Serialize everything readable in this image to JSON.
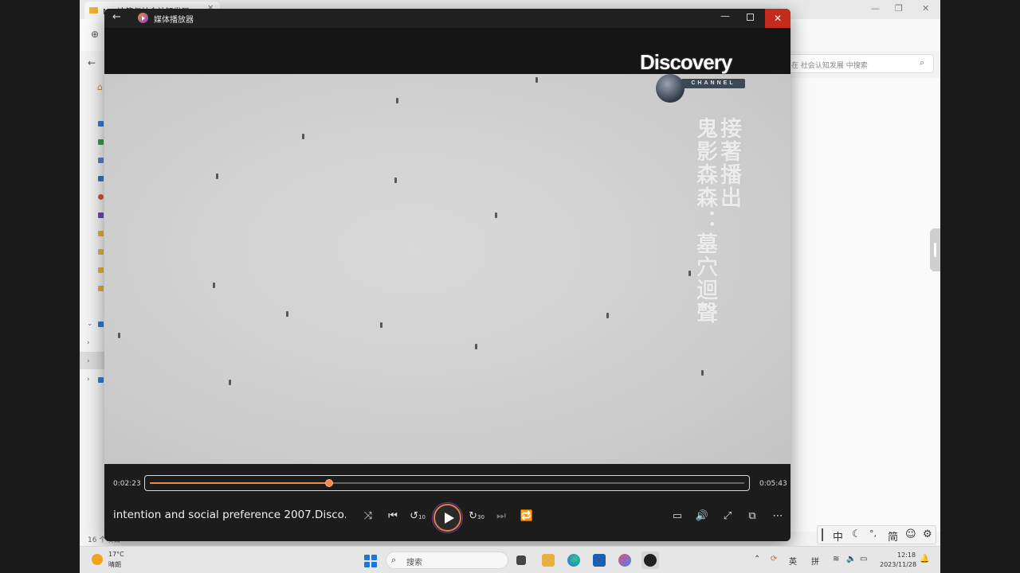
{
  "explorer": {
    "tab_title": "MCI决策与社会认知发展",
    "search_placeholder": "在 社会认知发展 中搜索",
    "status_text": "16 个项目"
  },
  "player": {
    "app_title": "媒体播放器",
    "media_title": "intention and social preference 2007.Disco...",
    "time_current": "0:02:23",
    "time_total": "0:05:43",
    "progress_fraction": 0.301,
    "logo_text": "Discovery",
    "logo_subtext": "CHANNEL",
    "caption_col1": "接著播出",
    "caption_col2": "鬼影森森：墓穴迴聲",
    "rewind_label": "10",
    "forward_label": "30"
  },
  "taskbar": {
    "weather_temp": "17°C",
    "weather_desc": "晴朗",
    "search_label": "搜索",
    "lang_label": "英",
    "ime_mode": "拼",
    "clock_time": "12:18",
    "clock_date": "2023/11/28"
  },
  "ime_toolbar": {
    "mode": "中",
    "punct": "°,",
    "charset": "简"
  },
  "colors": {
    "accent": "#f08a4b",
    "close_button": "#c42b1c",
    "titlebar": "#202020"
  }
}
